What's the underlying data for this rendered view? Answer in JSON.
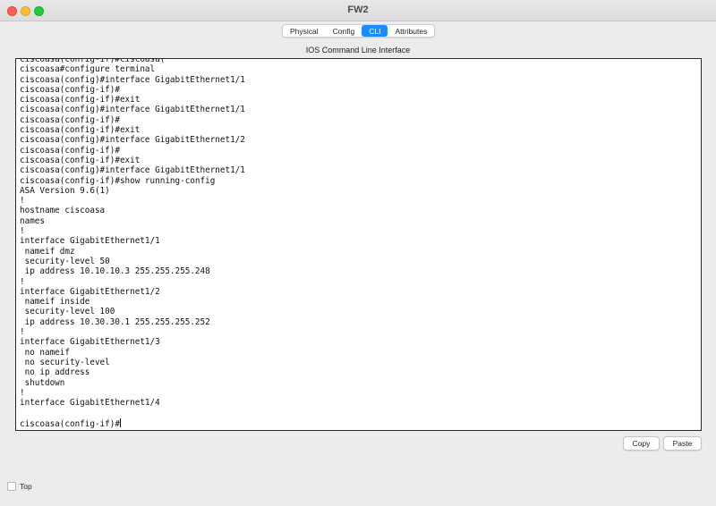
{
  "window": {
    "title": "FW2"
  },
  "tabs": [
    {
      "label": "Physical",
      "active": false
    },
    {
      "label": "Config",
      "active": false
    },
    {
      "label": "CLI",
      "active": true
    },
    {
      "label": "Attributes",
      "active": false
    }
  ],
  "cli": {
    "header": "IOS Command Line Interface",
    "lines": [
      "ciscoasa(config-if)#ciscoasa(",
      "ciscoasa#configure terminal",
      "ciscoasa(config)#interface GigabitEthernet1/1",
      "ciscoasa(config-if)#",
      "ciscoasa(config-if)#exit",
      "ciscoasa(config)#interface GigabitEthernet1/1",
      "ciscoasa(config-if)#",
      "ciscoasa(config-if)#exit",
      "ciscoasa(config)#interface GigabitEthernet1/2",
      "ciscoasa(config-if)#",
      "ciscoasa(config-if)#exit",
      "ciscoasa(config)#interface GigabitEthernet1/1",
      "ciscoasa(config-if)#show running-config",
      "ASA Version 9.6(1)",
      "!",
      "hostname ciscoasa",
      "names",
      "!",
      "interface GigabitEthernet1/1",
      " nameif dmz",
      " security-level 50",
      " ip address 10.10.10.3 255.255.255.248",
      "!",
      "interface GigabitEthernet1/2",
      " nameif inside",
      " security-level 100",
      " ip address 10.30.30.1 255.255.255.252",
      "!",
      "interface GigabitEthernet1/3",
      " no nameif",
      " no security-level",
      " no ip address",
      " shutdown",
      "!",
      "interface GigabitEthernet1/4",
      ""
    ],
    "prompt": "ciscoasa(config-if)#"
  },
  "buttons": {
    "copy": "Copy",
    "paste": "Paste"
  },
  "options": {
    "top_label": "Top",
    "top_checked": false
  },
  "colors": {
    "accent": "#1a8cff"
  },
  "icons": [
    "close-icon",
    "minimize-icon",
    "zoom-icon"
  ]
}
